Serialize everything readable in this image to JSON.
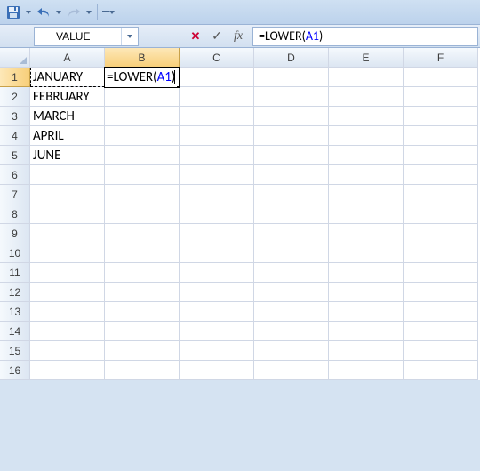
{
  "qat": {
    "save": "Save",
    "undo": "Undo",
    "redo": "Redo"
  },
  "namebox": {
    "value": "VALUE"
  },
  "formula_bar": {
    "cancel": "✕",
    "enter": "✓",
    "fx": "fx",
    "prefix": "=LOWER(",
    "ref": "A1",
    "suffix": ")"
  },
  "columns": [
    "A",
    "B",
    "C",
    "D",
    "E",
    "F"
  ],
  "rows": [
    "1",
    "2",
    "3",
    "4",
    "5",
    "6",
    "7",
    "8",
    "9",
    "10",
    "11",
    "12",
    "13",
    "14",
    "15",
    "16"
  ],
  "active_col": "B",
  "active_row": "1",
  "cells": {
    "A1": "JANUARY",
    "A2": "FEBRUARY",
    "A3": "MARCH",
    "A4": "APRIL",
    "A5": "JUNE"
  },
  "editing": {
    "cell": "B1",
    "prefix": "=LOWER(",
    "ref": "A1",
    "suffix": ")"
  }
}
